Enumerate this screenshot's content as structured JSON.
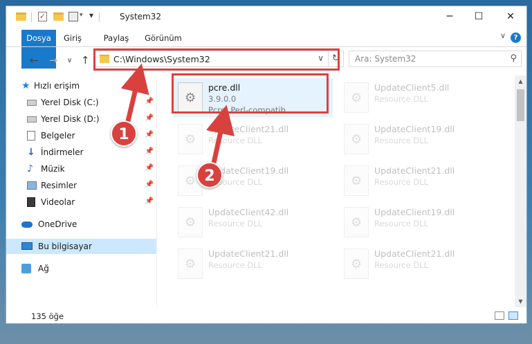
{
  "window": {
    "title": "System32",
    "minimize_glyph": "─",
    "maximize_glyph": "☐",
    "close_glyph": "✕"
  },
  "ribbon": {
    "tabs": [
      "Dosya",
      "Giriş",
      "Paylaş",
      "Görünüm"
    ],
    "collapse_glyph": "∨",
    "help_glyph": "?"
  },
  "navigation": {
    "back_glyph": "←",
    "forward_glyph": "→",
    "recent_glyph": "∨",
    "up_glyph": "↑",
    "address_path": "C:\\Windows\\System32",
    "address_dropdown_glyph": "∨",
    "refresh_glyph": "↻",
    "search_placeholder": "Ara: System32",
    "search_glyph": "⚲"
  },
  "sidebar": {
    "items": [
      {
        "label": "Hızlı erişim",
        "icon": "star-icon"
      },
      {
        "label": "Yerel Disk (C:)",
        "icon": "drive-icon",
        "pinned": true
      },
      {
        "label": "Yerel Disk (D:)",
        "icon": "drive-icon",
        "pinned": true
      },
      {
        "label": "Belgeler",
        "icon": "documents-icon",
        "pinned": true
      },
      {
        "label": "İndirmeler",
        "icon": "downloads-icon",
        "pinned": true
      },
      {
        "label": "Müzik",
        "icon": "music-icon",
        "pinned": true
      },
      {
        "label": "Resimler",
        "icon": "pictures-icon",
        "pinned": true
      },
      {
        "label": "Videolar",
        "icon": "videos-icon",
        "pinned": true
      },
      {
        "label": "OneDrive",
        "icon": "cloud-icon"
      },
      {
        "label": "Bu bilgisayar",
        "icon": "computer-icon",
        "selected": true
      },
      {
        "label": "Ağ",
        "icon": "network-icon"
      }
    ],
    "pin_glyph": "📌",
    "star_glyph": "★",
    "download_glyph": "↓",
    "music_glyph": "♪"
  },
  "files": [
    {
      "name": "pcre.dll",
      "version": "3.9.0.0",
      "description": "Pcre: Perl-compatib...",
      "highlighted": true
    },
    {
      "name": "UpdateClient5.dll",
      "description": "Resource DLL"
    },
    {
      "name": "UpdateClient21.dll",
      "description": "Resource DLL"
    },
    {
      "name": "UpdateClient19.dll",
      "description": "Resource DLL"
    },
    {
      "name": "UpdateClient19.dll",
      "description": "Resource DLL"
    },
    {
      "name": "UpdateClient21.dll",
      "description": "Resource DLL"
    },
    {
      "name": "UpdateClient42.dll",
      "description": "Resource DLL"
    },
    {
      "name": "UpdateClient19.dll",
      "description": "Resource DLL"
    },
    {
      "name": "UpdateClient21.dll",
      "description": "Resource DLL"
    },
    {
      "name": "UpdateClient21.dll",
      "description": "Resource DLL"
    }
  ],
  "file_icon_glyph": "⚙",
  "scrollbar": {
    "up_glyph": "▲",
    "down_glyph": "▼"
  },
  "status": {
    "item_count": "135 öğe"
  },
  "annotations": {
    "step1": "1",
    "step2": "2",
    "color": "#d9413f"
  }
}
